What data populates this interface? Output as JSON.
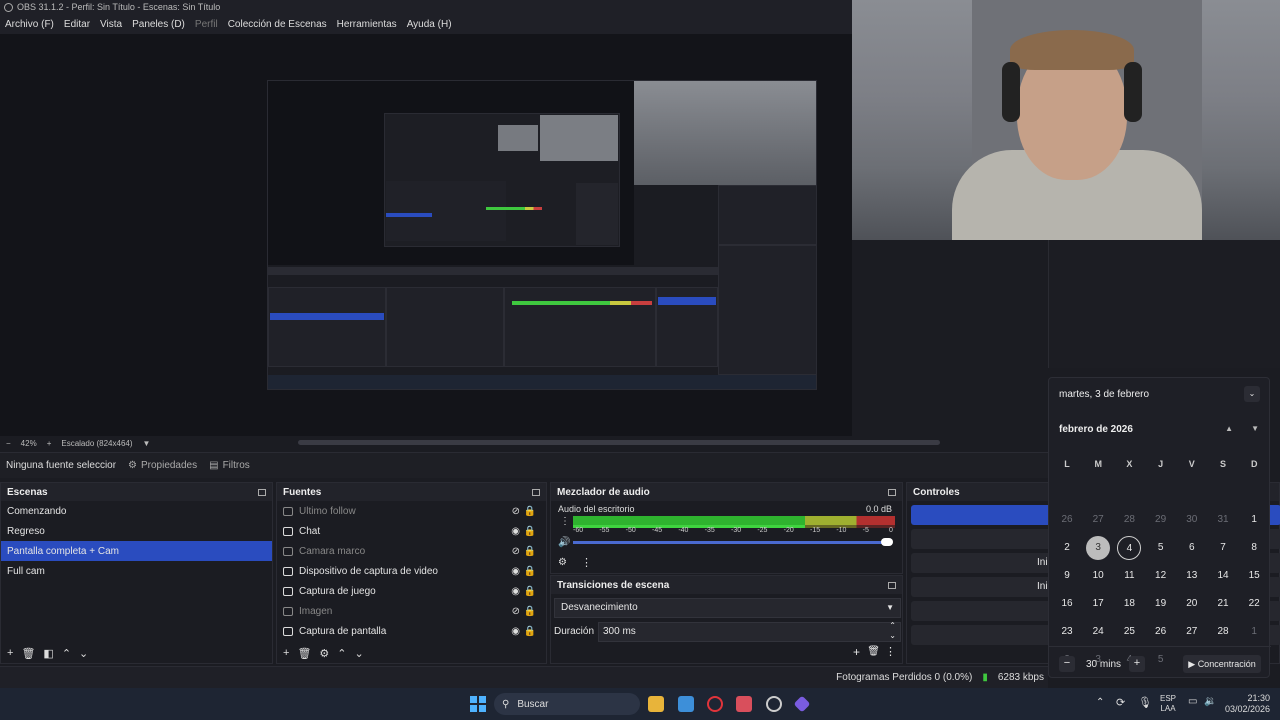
{
  "window": {
    "title": "OBS 31.1.2 - Perfil: Sin Título - Escenas: Sin Título"
  },
  "menu": [
    {
      "label": "Archivo (F)",
      "dim": false
    },
    {
      "label": "Editar",
      "dim": false
    },
    {
      "label": "Vista",
      "dim": false
    },
    {
      "label": "Paneles (D)",
      "dim": false
    },
    {
      "label": "Perfil",
      "dim": true
    },
    {
      "label": "Colección de Escenas",
      "dim": false
    },
    {
      "label": "Herramientas",
      "dim": false
    },
    {
      "label": "Ayuda (H)",
      "dim": false
    }
  ],
  "zoom": {
    "level": "42%",
    "scale": "Escalado (824x464)"
  },
  "source_bar": {
    "selection": "Ninguna fuente seleccionada",
    "properties": "Propiedades",
    "filters": "Filtros"
  },
  "scenes": {
    "title": "Escenas",
    "items": [
      {
        "label": "Comenzando",
        "active": false
      },
      {
        "label": "Regreso",
        "active": false
      },
      {
        "label": "Pantalla completa + Cam",
        "active": true
      },
      {
        "label": "Full cam",
        "active": false
      }
    ]
  },
  "sources": {
    "title": "Fuentes",
    "items": [
      {
        "label": "Ultimo follow",
        "icon": "browser-icon",
        "visible": false
      },
      {
        "label": "Chat",
        "icon": "browser-icon",
        "visible": true
      },
      {
        "label": "Camara marco",
        "icon": "image-icon",
        "visible": false
      },
      {
        "label": "Dispositivo de captura de video",
        "icon": "camera-icon",
        "visible": true
      },
      {
        "label": "Captura de juego",
        "icon": "gamepad-icon",
        "visible": true
      },
      {
        "label": "Imagen",
        "icon": "image-icon",
        "visible": false
      },
      {
        "label": "Captura de pantalla",
        "icon": "monitor-icon",
        "visible": true
      }
    ]
  },
  "mixer": {
    "title": "Mezclador de audio",
    "channel": "Audio del escritorio",
    "db": "0.0 dB",
    "ticks": [
      "-60",
      "-55",
      "-50",
      "-45",
      "-40",
      "-35",
      "-30",
      "-25",
      "-20",
      "-15",
      "-10",
      "-5",
      "0"
    ],
    "volume_fraction": 1.0
  },
  "transitions": {
    "title": "Transiciones de escena",
    "selected": "Desvanecimiento",
    "duration_label": "Duración",
    "duration_value": "300 ms"
  },
  "controls": {
    "title": "Controles",
    "btn3": "Ini",
    "btn4": "Ini"
  },
  "status": {
    "dropped": "Fotogramas Perdidos 0 (0.0%)",
    "bitrate": "6283 kbps"
  },
  "taskbar": {
    "search": "Buscar",
    "lang1": "ESP",
    "lang2": "LAA",
    "time": "21:30",
    "date": "03/02/2026"
  },
  "calendar": {
    "header_date": "martes, 3 de febrero",
    "month": "febrero de 2026",
    "dow": [
      "L",
      "M",
      "X",
      "J",
      "V",
      "S",
      "D"
    ],
    "weeks": [
      [
        "26",
        "27",
        "28",
        "29",
        "30",
        "31",
        "1"
      ],
      [
        "2",
        "3",
        "4",
        "5",
        "6",
        "7",
        "8"
      ],
      [
        "9",
        "10",
        "11",
        "12",
        "13",
        "14",
        "15"
      ],
      [
        "16",
        "17",
        "18",
        "19",
        "20",
        "21",
        "22"
      ],
      [
        "23",
        "24",
        "25",
        "26",
        "27",
        "28",
        "1"
      ],
      [
        "2",
        "3",
        "4",
        "5",
        "6",
        "7",
        "8"
      ]
    ],
    "other_month": [
      [
        0,
        0
      ],
      [
        0,
        1
      ],
      [
        0,
        2
      ],
      [
        0,
        3
      ],
      [
        0,
        4
      ],
      [
        0,
        5
      ],
      [
        4,
        6
      ],
      [
        5,
        0
      ],
      [
        5,
        1
      ],
      [
        5,
        2
      ],
      [
        5,
        3
      ],
      [
        5,
        4
      ],
      [
        5,
        5
      ],
      [
        5,
        6
      ]
    ],
    "today": [
      1,
      1
    ],
    "selected": [
      1,
      2
    ],
    "focus_minutes": "30 mins",
    "focus_button": "Concentración"
  }
}
